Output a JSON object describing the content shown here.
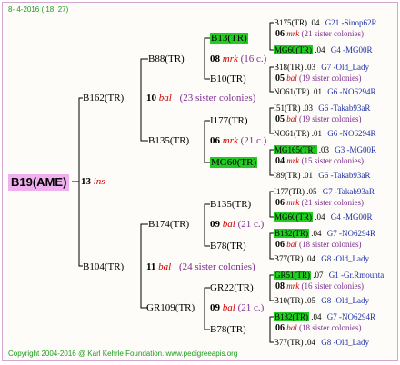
{
  "header": "8- 4-2016 ( 18: 27)",
  "footer": "Copyright 2004-2016 @ Karl Kehrle Foundation.   www.pedigreeapis.org",
  "root": {
    "name": "B19(AME)",
    "num": "13",
    "type": "ins"
  },
  "gen1": [
    {
      "name": "B162(TR)",
      "num": "10",
      "type": "bal",
      "sis": "(23 sister colonies)"
    },
    {
      "name": "B104(TR)",
      "num": "11",
      "type": "bal",
      "sis": "(24 sister colonies)"
    }
  ],
  "gen2": [
    {
      "name": "B88(TR)",
      "num": "08",
      "type": "mrk",
      "sis": "(16 c.)"
    },
    {
      "name": "B135(TR)",
      "num": "06",
      "type": "mrk",
      "sis": "(21 c.)"
    },
    {
      "name": "B174(TR)",
      "num": "09",
      "type": "bal",
      "sis": "(21 c.)"
    },
    {
      "name": "GR109(TR)",
      "num": "09",
      "type": "bal",
      "sis": "(21 c.)"
    }
  ],
  "gen3": [
    {
      "name": "B13(TR)",
      "hl": true
    },
    {
      "name": "B10(TR)",
      "hl": false
    },
    {
      "name": "I177(TR)",
      "hl": false
    },
    {
      "name": "MG60(TR)",
      "hl": true
    },
    {
      "name": "B135(TR)",
      "hl": false
    },
    {
      "name": "B78(TR)",
      "hl": false
    },
    {
      "name": "GR22(TR)",
      "hl": false
    },
    {
      "name": "B78(TR)",
      "hl": false
    }
  ],
  "gen4": [
    {
      "name": "B175(TR)",
      "year": ".04",
      "line": "G21 -Sinop62R",
      "num": "06",
      "type": "mrk",
      "sis": "(21 sister colonies)",
      "hl": false
    },
    {
      "name": "MG60(TR)",
      "year": ".04",
      "line": "G4 -MG00R",
      "num": "",
      "type": "",
      "sis": "",
      "hl": true
    },
    {
      "name": "B18(TR)",
      "year": ".03",
      "line": "G7 -Old_Lady",
      "num": "05",
      "type": "bal",
      "sis": "(19 sister colonies)",
      "hl": false
    },
    {
      "name": "NO61(TR)",
      "year": ".01",
      "line": "G6 -NO6294R",
      "num": "",
      "type": "",
      "sis": "",
      "hl": false
    },
    {
      "name": "I51(TR)",
      "year": ".03",
      "line": "G6 -Takab93aR",
      "num": "05",
      "type": "bal",
      "sis": "(19 sister colonies)",
      "hl": false
    },
    {
      "name": "NO61(TR)",
      "year": ".01",
      "line": "G6 -NO6294R",
      "num": "",
      "type": "",
      "sis": "",
      "hl": false
    },
    {
      "name": "MG165(TR)",
      "year": ".03",
      "line": "G3 -MG00R",
      "num": "04",
      "type": "mrk",
      "sis": "(15 sister colonies)",
      "hl": true
    },
    {
      "name": "I89(TR)",
      "year": ".01",
      "line": "G6 -Takab93aR",
      "num": "",
      "type": "",
      "sis": "",
      "hl": false
    },
    {
      "name": "I177(TR)",
      "year": ".05",
      "line": "G7 -Takab93aR",
      "num": "06",
      "type": "mrk",
      "sis": "(21 sister colonies)",
      "hl": false
    },
    {
      "name": "MG60(TR)",
      "year": ".04",
      "line": "G4 -MG00R",
      "num": "",
      "type": "",
      "sis": "",
      "hl": true
    },
    {
      "name": "B132(TR)",
      "year": ".04",
      "line": "G7 -NO6294R",
      "num": "06",
      "type": "bal",
      "sis": "(18 sister colonies)",
      "hl": true
    },
    {
      "name": "B77(TR)",
      "year": ".04",
      "line": "G8 -Old_Lady",
      "num": "",
      "type": "",
      "sis": "",
      "hl": false
    },
    {
      "name": "GR51(TR)",
      "year": ".07",
      "line": "G1 -Gr.Rmounta",
      "num": "08",
      "type": "mrk",
      "sis": "(16 sister colonies)",
      "hl": true
    },
    {
      "name": "B10(TR)",
      "year": ".05",
      "line": "G8 -Old_Lady",
      "num": "",
      "type": "",
      "sis": "",
      "hl": false
    },
    {
      "name": "B132(TR)",
      "year": ".04",
      "line": "G7 -NO6294R",
      "num": "06",
      "type": "bal",
      "sis": "(18 sister colonies)",
      "hl": true
    },
    {
      "name": "B77(TR)",
      "year": ".04",
      "line": "G8 -Old_Lady",
      "num": "",
      "type": "",
      "sis": "",
      "hl": false
    }
  ]
}
